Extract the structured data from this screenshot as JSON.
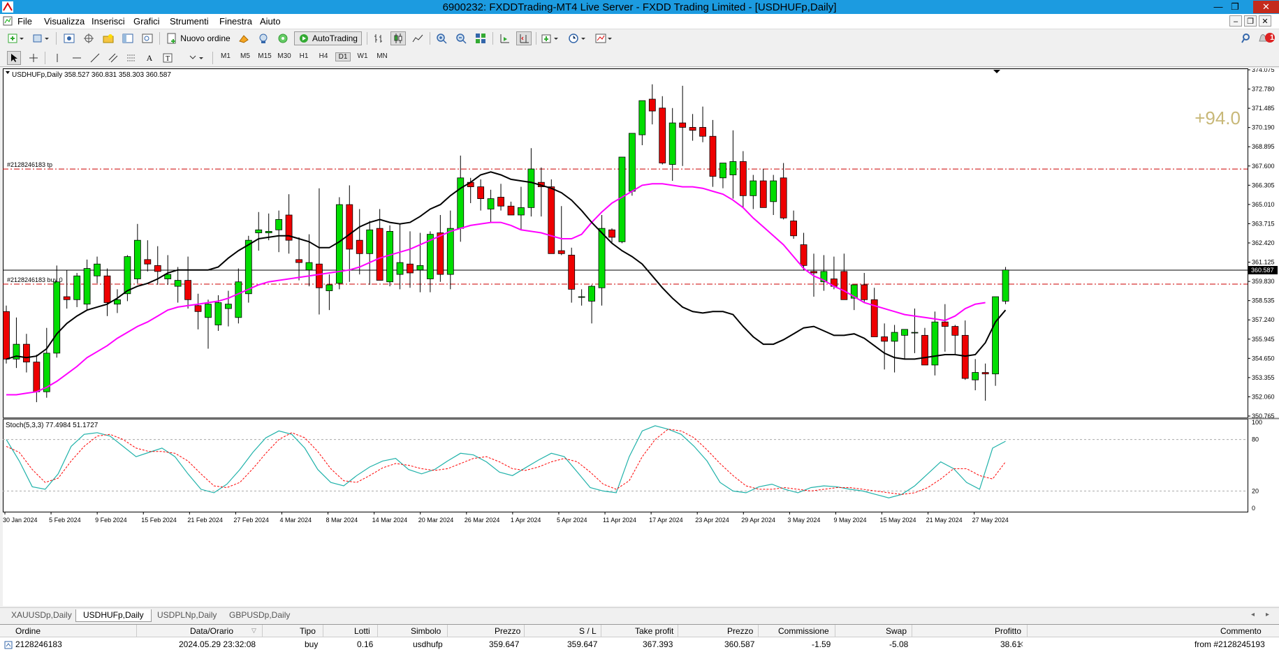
{
  "window": {
    "title": "6900232: FXDDTrading-MT4 Live Server - FXDD Trading Limited - [USDHUFp,Daily]"
  },
  "menu": [
    "File",
    "Visualizza",
    "Inserisci",
    "Grafici",
    "Strumenti",
    "Finestra",
    "Aiuto"
  ],
  "toolbar": {
    "new_order_label": "Nuovo ordine",
    "autotrading_label": "AutoTrading",
    "timeframes": [
      "M1",
      "M5",
      "M15",
      "M30",
      "H1",
      "H4",
      "D1",
      "W1",
      "MN"
    ],
    "active_timeframe": "D1",
    "notification_count": "1"
  },
  "chart": {
    "symbol_header": "USDHUFp,Daily  358.527 360.831 358.303 360.587",
    "profit_overlay": "+94.0",
    "tp_label": "#2128246183 tp",
    "buy_label": "#2128246183 buy 0",
    "price_axis": [
      "374.075",
      "372.780",
      "371.485",
      "370.190",
      "368.895",
      "367.600",
      "366.305",
      "365.010",
      "363.715",
      "362.420",
      "361.125",
      "359.830",
      "358.535",
      "357.240",
      "355.945",
      "354.650",
      "353.355",
      "352.060",
      "350.765"
    ],
    "current_price": "360.587",
    "tp_price": 367.393,
    "entry_price": 359.647,
    "ylim": [
      350.765,
      374.075
    ],
    "colors": {
      "bull": "#00dd00",
      "bear": "#ee0000",
      "ma_fast": "#000000",
      "ma_slow": "#ff00ff",
      "tp_line": "#cc0000"
    },
    "dates": [
      "30 Jan 2024",
      "5 Feb 2024",
      "9 Feb 2024",
      "15 Feb 2024",
      "21 Feb 2024",
      "27 Feb 2024",
      "4 Mar 2024",
      "8 Mar 2024",
      "14 Mar 2024",
      "20 Mar 2024",
      "26 Mar 2024",
      "1 Apr 2024",
      "5 Apr 2024",
      "11 Apr 2024",
      "17 Apr 2024",
      "23 Apr 2024",
      "29 Apr 2024",
      "3 May 2024",
      "9 May 2024",
      "15 May 2024",
      "21 May 2024",
      "27 May 2024"
    ]
  },
  "indicator": {
    "header": "Stoch(5,3,3) 77.4984 51.1727",
    "levels": [
      "100",
      "80",
      "20",
      "0"
    ],
    "colors": {
      "main": "#20b2aa",
      "signal": "#ff0000"
    }
  },
  "chart_data": {
    "type": "candlestick",
    "candles": [
      [
        357.8,
        358.2,
        354.3,
        354.6
      ],
      [
        354.6,
        357.4,
        354.0,
        355.6
      ],
      [
        355.6,
        356.3,
        353.7,
        354.4
      ],
      [
        354.4,
        354.9,
        351.7,
        352.4
      ],
      [
        352.4,
        356.7,
        352.0,
        355.0
      ],
      [
        355.0,
        360.9,
        354.7,
        359.8
      ],
      [
        358.8,
        360.6,
        358.0,
        358.6
      ],
      [
        358.6,
        360.4,
        358.1,
        360.2
      ],
      [
        358.3,
        361.3,
        357.9,
        360.7
      ],
      [
        360.2,
        361.5,
        359.7,
        361.0
      ],
      [
        360.2,
        360.7,
        357.5,
        358.4
      ],
      [
        358.3,
        359.3,
        357.7,
        358.6
      ],
      [
        359.0,
        361.6,
        358.5,
        361.5
      ],
      [
        360.0,
        363.7,
        359.7,
        362.6
      ],
      [
        361.3,
        362.6,
        360.5,
        361.0
      ],
      [
        360.9,
        362.2,
        359.6,
        360.5
      ],
      [
        360.0,
        361.6,
        359.6,
        360.3
      ],
      [
        359.5,
        360.8,
        358.4,
        359.9
      ],
      [
        359.9,
        361.5,
        358.0,
        358.6
      ],
      [
        358.2,
        359.0,
        356.6,
        357.8
      ],
      [
        357.4,
        358.6,
        355.3,
        358.3
      ],
      [
        356.9,
        358.9,
        356.5,
        358.4
      ],
      [
        358.0,
        359.2,
        356.8,
        358.3
      ],
      [
        357.4,
        360.7,
        357.0,
        359.8
      ],
      [
        359.0,
        362.9,
        358.4,
        362.6
      ],
      [
        363.1,
        364.5,
        361.9,
        363.3
      ],
      [
        363.1,
        364.4,
        362.6,
        363.2
      ],
      [
        363.3,
        364.6,
        361.8,
        364.0
      ],
      [
        364.3,
        365.7,
        361.7,
        362.6
      ],
      [
        361.3,
        362.8,
        359.9,
        361.1
      ],
      [
        360.6,
        363.0,
        359.5,
        361.1
      ],
      [
        361.0,
        366.1,
        357.6,
        359.4
      ],
      [
        359.2,
        360.3,
        357.9,
        359.6
      ],
      [
        359.7,
        365.5,
        359.3,
        365.0
      ],
      [
        365.0,
        366.3,
        359.8,
        362.0
      ],
      [
        362.6,
        364.7,
        360.3,
        361.7
      ],
      [
        361.7,
        363.9,
        359.6,
        363.3
      ],
      [
        363.4,
        364.7,
        360.1,
        359.9
      ],
      [
        359.8,
        363.6,
        359.5,
        363.2
      ],
      [
        360.3,
        363.7,
        359.3,
        361.1
      ],
      [
        361.0,
        363.2,
        359.4,
        360.4
      ],
      [
        360.6,
        363.1,
        359.1,
        360.9
      ],
      [
        360.0,
        363.2,
        359.1,
        363.0
      ],
      [
        363.1,
        364.3,
        359.8,
        360.3
      ],
      [
        360.3,
        364.6,
        359.3,
        363.4
      ],
      [
        363.4,
        368.3,
        362.5,
        366.8
      ],
      [
        366.5,
        366.8,
        365.1,
        366.2
      ],
      [
        366.2,
        366.7,
        364.6,
        365.4
      ],
      [
        364.7,
        366.0,
        363.8,
        365.4
      ],
      [
        365.5,
        366.4,
        364.6,
        364.9
      ],
      [
        364.9,
        365.2,
        364.4,
        364.3
      ],
      [
        364.3,
        366.2,
        363.3,
        364.8
      ],
      [
        364.8,
        368.8,
        364.2,
        367.4
      ],
      [
        366.5,
        367.5,
        364.2,
        366.2
      ],
      [
        366.2,
        366.7,
        361.7,
        361.7
      ],
      [
        361.9,
        364.9,
        361.6,
        361.7
      ],
      [
        361.6,
        362.1,
        358.4,
        359.3
      ],
      [
        358.8,
        359.3,
        358.2,
        358.8
      ],
      [
        358.5,
        359.6,
        357.0,
        359.5
      ],
      [
        359.4,
        364.3,
        358.2,
        363.4
      ],
      [
        363.3,
        363.4,
        362.4,
        362.8
      ],
      [
        362.5,
        368.1,
        362.4,
        368.2
      ],
      [
        365.9,
        368.9,
        365.6,
        369.8
      ],
      [
        369.7,
        371.7,
        369.0,
        372.0
      ],
      [
        372.1,
        373.1,
        370.4,
        371.3
      ],
      [
        371.5,
        372.3,
        367.7,
        367.8
      ],
      [
        367.7,
        371.5,
        366.6,
        370.5
      ],
      [
        370.5,
        373.0,
        367.6,
        370.2
      ],
      [
        370.2,
        371.1,
        369.3,
        370.0
      ],
      [
        370.2,
        371.6,
        369.2,
        369.6
      ],
      [
        369.6,
        370.7,
        366.2,
        366.9
      ],
      [
        366.8,
        367.8,
        366.1,
        367.8
      ],
      [
        367.0,
        370.0,
        365.4,
        367.9
      ],
      [
        367.9,
        368.6,
        364.8,
        365.6
      ],
      [
        365.6,
        367.0,
        364.7,
        366.6
      ],
      [
        366.6,
        367.4,
        365.0,
        364.8
      ],
      [
        365.2,
        367.0,
        364.3,
        366.6
      ],
      [
        366.8,
        367.8,
        364.0,
        364.1
      ],
      [
        363.9,
        364.6,
        362.7,
        362.9
      ],
      [
        362.3,
        363.1,
        360.6,
        360.9
      ],
      [
        360.5,
        361.7,
        358.8,
        360.4
      ],
      [
        359.8,
        361.6,
        359.2,
        360.5
      ],
      [
        360.0,
        361.5,
        359.3,
        359.5
      ],
      [
        360.5,
        361.7,
        359.4,
        358.6
      ],
      [
        358.7,
        359.6,
        357.9,
        359.6
      ],
      [
        359.6,
        360.4,
        358.4,
        358.6
      ],
      [
        358.6,
        359.4,
        357.4,
        356.1
      ],
      [
        356.1,
        357.0,
        353.9,
        355.8
      ],
      [
        355.8,
        356.9,
        353.7,
        356.4
      ],
      [
        356.2,
        356.4,
        354.6,
        356.6
      ],
      [
        356.4,
        358.0,
        355.0,
        356.4
      ],
      [
        356.2,
        356.7,
        355.1,
        354.2
      ],
      [
        354.2,
        357.8,
        353.5,
        357.1
      ],
      [
        357.1,
        358.3,
        355.1,
        356.8
      ],
      [
        356.8,
        356.9,
        354.9,
        356.2
      ],
      [
        356.2,
        357.2,
        353.2,
        353.3
      ],
      [
        353.2,
        354.6,
        352.5,
        353.7
      ],
      [
        353.7,
        354.3,
        351.8,
        353.6
      ],
      [
        353.6,
        358.8,
        352.8,
        358.8
      ],
      [
        358.5,
        360.8,
        358.3,
        360.6
      ]
    ],
    "ma_fast": [
      354.6,
      354.8,
      354.7,
      354.8,
      355.3,
      356.3,
      357.0,
      357.5,
      357.9,
      358.1,
      358.3,
      358.7,
      359.2,
      359.5,
      359.7,
      360.0,
      360.4,
      360.6,
      360.6,
      360.6,
      360.6,
      360.8,
      361.4,
      361.9,
      362.3,
      362.7,
      362.8,
      362.9,
      362.9,
      362.7,
      362.5,
      362.1,
      362.1,
      362.5,
      363.0,
      363.5,
      363.8,
      364.0,
      363.8,
      363.7,
      363.8,
      364.2,
      364.7,
      365.0,
      365.6,
      366.1,
      366.5,
      367.0,
      367.2,
      367.0,
      366.7,
      366.6,
      366.5,
      366.3,
      366.1,
      365.8,
      365.3,
      364.6,
      363.8,
      363.1,
      362.4,
      361.9,
      361.5,
      361.0,
      360.2,
      359.4,
      358.7,
      358.1,
      357.8,
      357.7,
      357.8,
      357.8,
      357.6,
      356.8,
      356.1,
      355.6,
      355.6,
      355.9,
      356.3,
      356.7,
      356.8,
      356.5,
      356.2,
      356.2,
      356.3,
      356.0,
      355.5,
      355.0,
      354.7,
      354.6,
      354.6,
      354.7,
      354.8,
      354.9,
      354.9,
      354.8,
      354.9,
      355.7,
      357.1,
      357.9
    ],
    "ma_slow": [
      352.2,
      352.2,
      352.3,
      352.4,
      352.7,
      353.1,
      353.6,
      354.1,
      354.7,
      355.1,
      355.5,
      356.0,
      356.4,
      356.8,
      357.1,
      357.5,
      357.9,
      358.1,
      358.2,
      358.3,
      358.4,
      358.5,
      358.7,
      359.0,
      359.3,
      359.6,
      359.8,
      359.9,
      360.0,
      360.1,
      360.2,
      360.3,
      360.4,
      360.5,
      360.6,
      360.8,
      361.1,
      361.4,
      361.6,
      361.8,
      362.0,
      362.3,
      362.6,
      362.9,
      363.2,
      363.4,
      363.6,
      363.7,
      363.8,
      363.8,
      363.6,
      363.3,
      363.2,
      363.1,
      362.9,
      362.7,
      362.7,
      363.0,
      363.8,
      364.5,
      365.1,
      365.5,
      365.9,
      366.3,
      366.4,
      366.4,
      366.3,
      366.2,
      366.2,
      366.1,
      365.9,
      365.7,
      365.3,
      364.8,
      364.1,
      363.5,
      362.9,
      362.3,
      361.5,
      360.7,
      360.2,
      359.9,
      359.5,
      359.2,
      358.8,
      358.4,
      358.2,
      358.0,
      357.8,
      357.6,
      357.5,
      357.4,
      357.3,
      357.2,
      357.5,
      358.0,
      358.3,
      358.4
    ]
  },
  "stoch": {
    "main": [
      80,
      55,
      25,
      22,
      40,
      72,
      86,
      88,
      84,
      72,
      60,
      65,
      70,
      60,
      40,
      22,
      18,
      28,
      45,
      65,
      82,
      90,
      86,
      70,
      45,
      30,
      26,
      38,
      48,
      55,
      58,
      45,
      40,
      45,
      55,
      64,
      62,
      54,
      42,
      38,
      47,
      56,
      64,
      60,
      42,
      24,
      20,
      18,
      60,
      90,
      96,
      92,
      86,
      72,
      55,
      30,
      20,
      18,
      25,
      28,
      22,
      18,
      24,
      26,
      25,
      22,
      20,
      16,
      12,
      16,
      26,
      40,
      54,
      46,
      30,
      22,
      70,
      78
    ],
    "signal": [
      72,
      65,
      45,
      30,
      35,
      55,
      72,
      84,
      86,
      80,
      70,
      66,
      66,
      64,
      55,
      40,
      26,
      24,
      30,
      46,
      64,
      80,
      88,
      82,
      66,
      46,
      32,
      30,
      38,
      47,
      52,
      50,
      46,
      44,
      46,
      52,
      58,
      60,
      54,
      46,
      44,
      48,
      54,
      58,
      54,
      42,
      28,
      22,
      32,
      60,
      80,
      92,
      90,
      82,
      68,
      52,
      38,
      26,
      22,
      22,
      24,
      22,
      20,
      22,
      24,
      24,
      22,
      20,
      18,
      16,
      18,
      24,
      34,
      46,
      46,
      38,
      34,
      54
    ]
  },
  "tabs": [
    "XAUUSDp,Daily",
    "USDHUFp,Daily",
    "USDPLNp,Daily",
    "GBPUSDp,Daily"
  ],
  "active_tab": "USDHUFp,Daily",
  "terminal": {
    "headers": [
      "Ordine",
      "Data/Orario",
      "Tipo",
      "Lotti",
      "Simbolo",
      "Prezzo",
      "S / L",
      "Take profit",
      "Prezzo",
      "Commissione",
      "Swap",
      "Profitto",
      "Commento"
    ],
    "row": [
      "2128246183",
      "2024.05.29 23:32:08",
      "buy",
      "0.16",
      "usdhufp",
      "359.647",
      "359.647",
      "367.393",
      "360.587",
      "-1.59",
      "-5.08",
      "38.61",
      "from #2128245193"
    ]
  }
}
